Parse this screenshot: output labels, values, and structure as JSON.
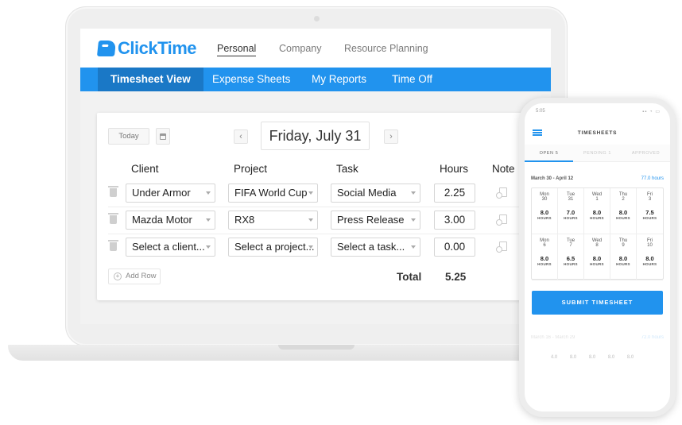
{
  "laptop": {
    "brand": "ClickTime",
    "top_nav": [
      "Personal",
      "Company",
      "Resource Planning"
    ],
    "tabs": [
      "Timesheet View",
      "Expense Sheets",
      "My Reports",
      "Time Off"
    ],
    "toolbar": {
      "today_label": "Today",
      "date": "Friday, July 31",
      "prev": "‹",
      "next": "›"
    },
    "columns": {
      "client": "Client",
      "project": "Project",
      "task": "Task",
      "hours": "Hours",
      "note": "Note"
    },
    "rows": [
      {
        "client": "Under Armor",
        "project": "FIFA World Cup",
        "task": "Social Media",
        "hours": "2.25"
      },
      {
        "client": "Mazda Motor",
        "project": "RX8",
        "task": "Press Release",
        "hours": "3.00"
      },
      {
        "client": "Select a client...",
        "project": "Select a project...",
        "task": "Select a task...",
        "hours": "0.00"
      }
    ],
    "add_row_label": "Add Row",
    "total_label": "Total",
    "total_value": "5.25"
  },
  "phone": {
    "status_time": "5:05",
    "title": "TIMESHEETS",
    "tabs": [
      "OPEN 5",
      "PENDING 1",
      "APPROVED"
    ],
    "range": "March 30 - April 12",
    "range_hours": "77.0 hours",
    "week1": [
      {
        "dow": "Mon",
        "day": "30",
        "hours": "8.0"
      },
      {
        "dow": "Tue",
        "day": "31",
        "hours": "7.0"
      },
      {
        "dow": "Wed",
        "day": "1",
        "hours": "8.0"
      },
      {
        "dow": "Thu",
        "day": "2",
        "hours": "8.0"
      },
      {
        "dow": "Fri",
        "day": "3",
        "hours": "7.5"
      }
    ],
    "week2": [
      {
        "dow": "Mon",
        "day": "6",
        "hours": "8.0"
      },
      {
        "dow": "Tue",
        "day": "7",
        "hours": "6.5"
      },
      {
        "dow": "Wed",
        "day": "8",
        "hours": "8.0"
      },
      {
        "dow": "Thu",
        "day": "9",
        "hours": "8.0"
      },
      {
        "dow": "Fri",
        "day": "10",
        "hours": "8.0"
      }
    ],
    "hours_unit": "HOURS",
    "submit_label": "SUBMIT TIMESHEET",
    "faded_range": "March 16 - March 29",
    "faded_hours": "72.0 hours",
    "faded_values": [
      "4.0",
      "8.0",
      "8.0",
      "8.0",
      "8.0"
    ]
  }
}
